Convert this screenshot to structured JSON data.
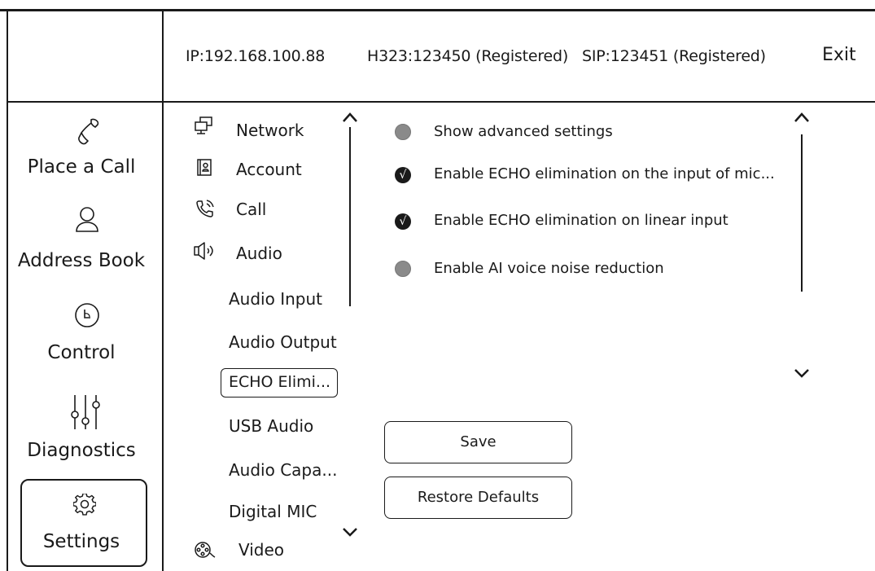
{
  "header": {
    "ip": "IP:192.168.100.88",
    "h323": "H323:123450 (Registered)",
    "sip": "SIP:123451 (Registered)",
    "exit_label": "Exit"
  },
  "sidebar": {
    "items": [
      {
        "label": "Place a Call",
        "icon": "phone-icon"
      },
      {
        "label": "Address Book",
        "icon": "person-icon"
      },
      {
        "label": "Control",
        "icon": "clock-icon"
      },
      {
        "label": "Diagnostics",
        "icon": "sliders-icon"
      },
      {
        "label": "Settings",
        "icon": "gear-icon",
        "selected": true
      }
    ]
  },
  "menu": {
    "items": [
      {
        "label": "Network",
        "icon": "network-icon"
      },
      {
        "label": "Account",
        "icon": "account-icon"
      },
      {
        "label": "Call",
        "icon": "call-icon"
      },
      {
        "label": "Audio",
        "icon": "speaker-icon"
      }
    ],
    "audio_sub": [
      {
        "label": "Audio Input"
      },
      {
        "label": "Audio Output"
      },
      {
        "label": "ECHO Elimi...",
        "selected": true
      },
      {
        "label": "USB Audio"
      },
      {
        "label": "Audio Capa..."
      },
      {
        "label": "Digital MIC"
      }
    ],
    "video": {
      "label": "Video",
      "icon": "video-icon"
    }
  },
  "options": [
    {
      "label": "Show advanced settings",
      "checked": false
    },
    {
      "label": "Enable ECHO elimination on the input of mic...",
      "checked": true
    },
    {
      "label": "Enable ECHO elimination on linear input",
      "checked": true
    },
    {
      "label": "Enable AI voice noise reduction",
      "checked": false
    }
  ],
  "check_glyph": "√",
  "buttons": {
    "save": "Save",
    "restore": "Restore Defaults"
  }
}
